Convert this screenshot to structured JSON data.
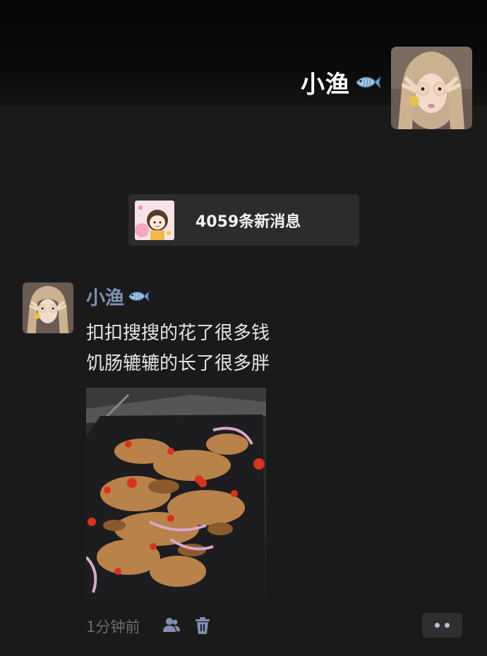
{
  "profile": {
    "name": "小渔"
  },
  "new_messages": {
    "label": "4059条新消息"
  },
  "post": {
    "author": "小渔",
    "text_line1": "扣扣搜搜的花了很多钱",
    "text_line2": "饥肠辘辘的长了很多胖",
    "time": "1分钟前"
  },
  "colors": {
    "background": "#1a1a1a",
    "author_name": "#7e91b4",
    "badge_bg": "#2c2c2c"
  },
  "icons": {
    "name_badge": "fish-icon",
    "privacy": "friends-icon",
    "delete": "trash-icon",
    "more": "more-dots-icon"
  }
}
